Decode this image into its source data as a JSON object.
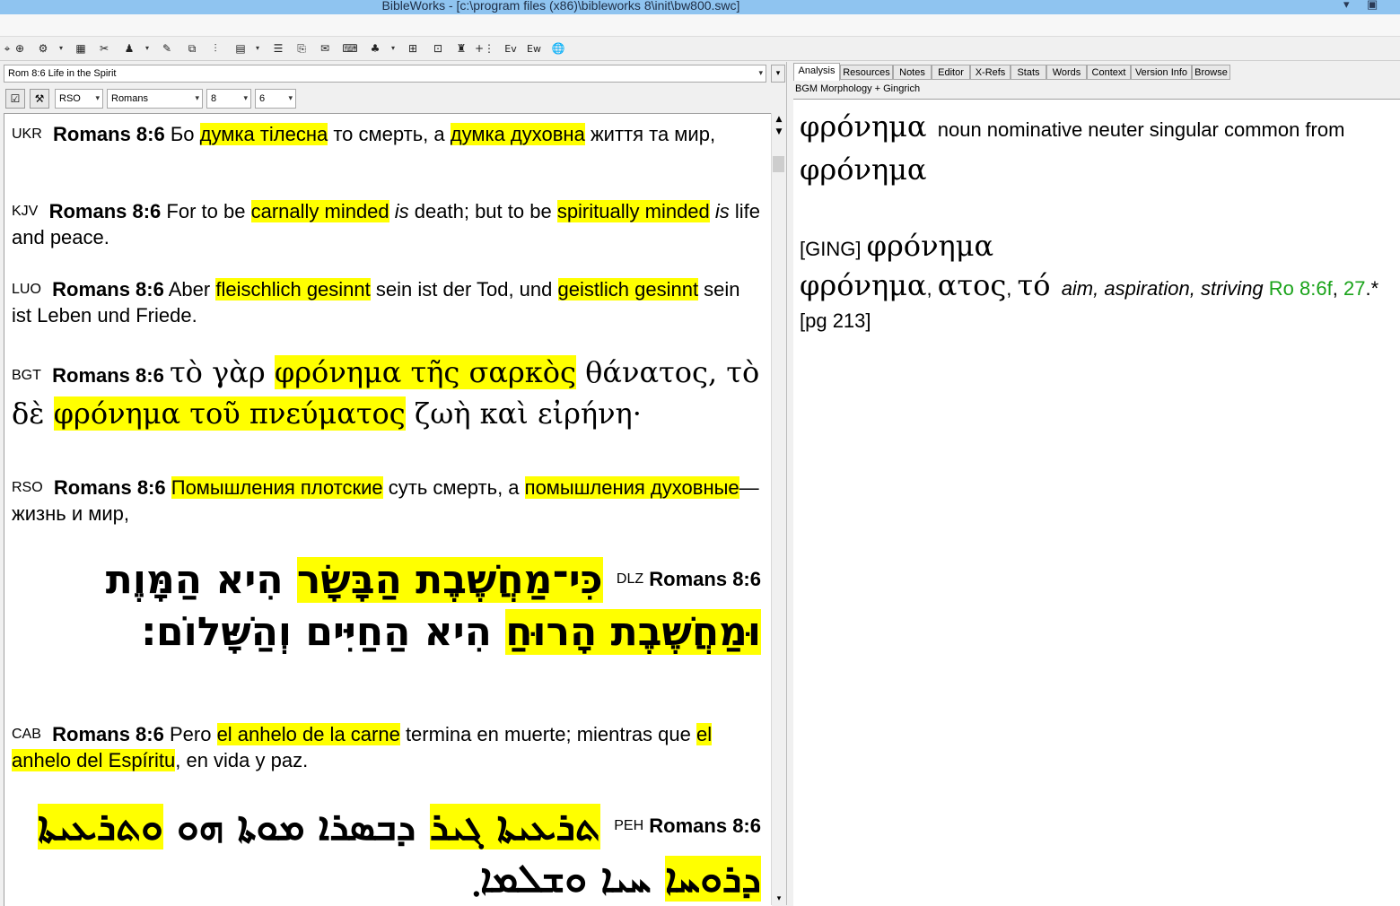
{
  "window": {
    "title": "BibleWorks - [c:\\program files (x86)\\bibleworks 8\\init\\bw800.swc]",
    "controls": [
      "▾",
      "▣"
    ]
  },
  "toolbar": {
    "icons": [
      "⌖",
      "⊕",
      "⚙",
      "▦",
      "✂",
      "♟",
      "✎",
      "⧉",
      "⫶",
      "▤",
      "☰",
      "⎘",
      "✉",
      "⌨",
      "♣",
      "⊞",
      "⊡",
      "♜",
      "+⋮",
      "Ev",
      "Ew",
      "🌐"
    ],
    "dropdown_glyph": "▾"
  },
  "verse_selector": {
    "value": "Rom 8:6 Life in the Spirit",
    "arrow": "▾",
    "side_arrow": "▾"
  },
  "controls": {
    "version": "RSO",
    "book": "Romans",
    "chapter": "8",
    "verse": "6",
    "check_icon": "☑",
    "tool_icon": "⚒",
    "arrow": "▾"
  },
  "scroll": {
    "up": "▲",
    "down": "▼",
    "bottom": "▾"
  },
  "verses": [
    {
      "tag": "UKR",
      "ref": "Romans 8:6",
      "p1": " Бо ",
      "h1": "думка тілесна",
      "p2": " то смерть, а ",
      "h2": "думка духовна",
      "p3": " життя та мир,"
    },
    {
      "tag": "KJV",
      "ref": "Romans 8:6",
      "p1": " For to be ",
      "h1": "carnally minded",
      "i1": "is",
      "p2": " death; but to be ",
      "h2": "spiritually minded",
      "i2": "is",
      "p3": " life and peace."
    },
    {
      "tag": "LUO",
      "ref": "Romans 8:6",
      "p1": " Aber ",
      "h1": "fleischlich gesinnt",
      "p2": " sein ist der Tod, und ",
      "h2": "geistlich gesinnt",
      "p3": " sein ist Leben und Friede."
    },
    {
      "tag": "BGT",
      "ref": "Romans 8:6",
      "p1": "τὸ γὰρ ",
      "h1": "φρόνημα τῆς σαρκὸς",
      "p2": " θάνατος, τὸ δὲ ",
      "h2": "φρόνημα τοῦ πνεύματος",
      "p3": " ζωὴ καὶ εἰρήνη·"
    },
    {
      "tag": "RSO",
      "ref": "Romans 8:6",
      "p1": " ",
      "h1": "Помышления плотские",
      "p2": " суть смерть, а ",
      "h2": "помышления духовные",
      "p3": "— жизнь и мир,"
    },
    {
      "tag": "DLZ",
      "ref": "Romans 8:6",
      "h1": "כִּי־מַחֲשֶׁבֶת הַבָּשָׂר",
      "p2": " הִיא הַמָּוֶת ",
      "h2": "וּמַחֲשֶׁבֶת הָרוּחַ",
      "p3": " הִיא הַחַיִּים וְהַשָּׁלוֹם׃"
    },
    {
      "tag": "CAB",
      "ref": "Romans 8:6",
      "p1": " Pero ",
      "h1": "el anhelo de la carne",
      "p2": " termina en muerte; mientras que ",
      "h2": "el anhelo del Espíritu",
      "p3": ", en vida y paz."
    },
    {
      "tag": "PEH",
      "ref": "Romans 8:6",
      "h1": "ܬܪܥܝܬܐ ܓܝܪ",
      "p2": " ܕܒܣܪܐ ܡܘܬܐ ܗܘ ",
      "h2": "ܘܬܪܥܝܬܐ ܕܪܘܚܐ",
      "p3": " ܚܝܐ ܘܫܠܡܐ܂"
    }
  ],
  "right": {
    "tabs": [
      "Analysis",
      "Resources",
      "Notes",
      "Editor",
      "X-Refs",
      "Stats",
      "Words",
      "Context",
      "Version Info",
      "Browse"
    ],
    "active_tab": "Analysis",
    "subheader": "BGM Morphology + Gingrich",
    "analysis": {
      "word": "φρόνημα",
      "parse": "noun nominative neuter singular common from",
      "lemma": "φρόνημα"
    },
    "lexicon": {
      "tag": "[GING]",
      "head": "φρόνημα",
      "entry_word": "φρόνημα",
      "sep1": ", ",
      "gen": "ατος",
      "sep2": ", ",
      "art": "τό",
      "gloss": "aim, aspiration, striving",
      "ref1": "Ro 8:6f",
      "comma": ",",
      "ref2": "27",
      "tail": ".* [pg 213]"
    }
  }
}
